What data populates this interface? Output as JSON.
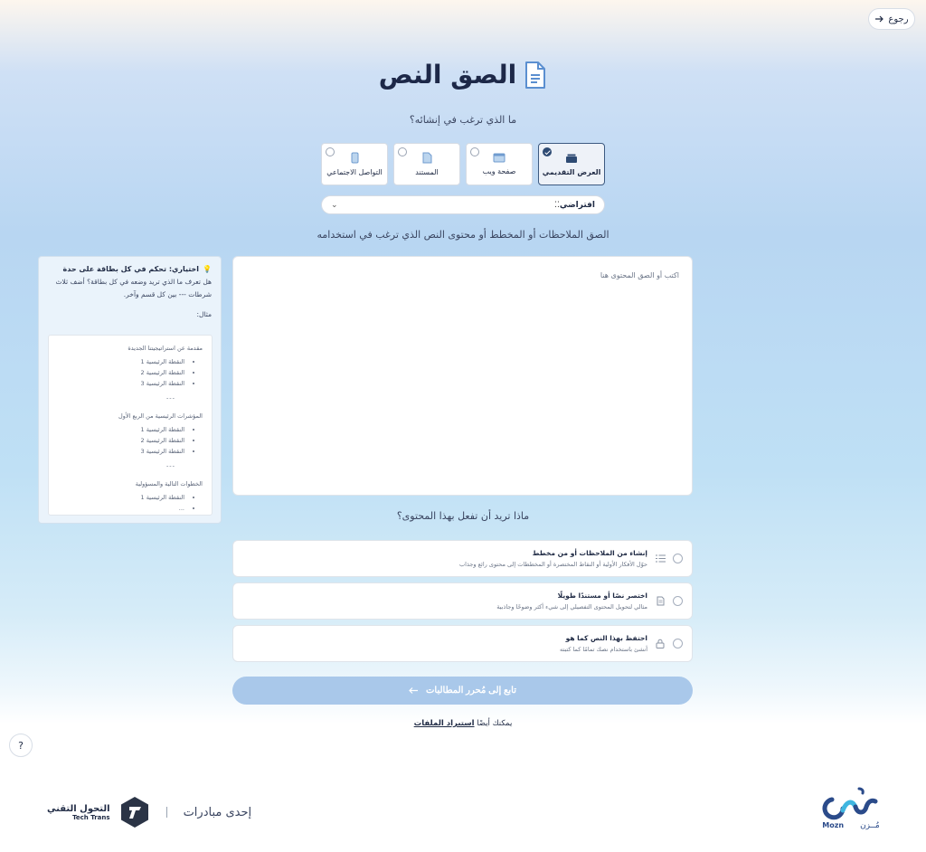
{
  "nav": {
    "back_label": "رجوع"
  },
  "page": {
    "title": "الصق النص",
    "subtitle": "ما الذي ترغب في إنشائه؟"
  },
  "types": [
    {
      "label": "العرض التقديمي",
      "selected": true,
      "icon": "layers-icon"
    },
    {
      "label": "صفحة ويب",
      "selected": false,
      "icon": "webpage-icon"
    },
    {
      "label": "المستند",
      "selected": false,
      "icon": "document-icon"
    },
    {
      "label": "التواصل الاجتماعي",
      "selected": false,
      "icon": "phone-icon"
    }
  ],
  "theme": {
    "value": "افتراضي"
  },
  "paste": {
    "label": "الصق الملاحظات أو المخطط أو محتوى النص الذي ترغب في استخدامه",
    "placeholder": "اكتب أو الصق المحتوى هنا"
  },
  "tip": {
    "title": "اختياري: تحكم في كل بطاقة على حدة",
    "body": "هل تعرف ما الذي تريد وضعه في كل بطاقة؟ أضف ثلاث شرطات --- بين كل قسم وآخر.",
    "example_label": "مثال:",
    "sections": [
      {
        "heading": "مقدمة عن استراتيجيتنا الجديدة",
        "points": [
          "النقطة الرئيسية 1",
          "النقطة الرئيسية 2",
          "النقطة الرئيسية 3"
        ]
      },
      {
        "heading": "المؤشرات الرئيسية من الربع الأول",
        "points": [
          "النقطة الرئيسية 1",
          "النقطة الرئيسية 2",
          "النقطة الرئيسية 3"
        ]
      },
      {
        "heading": "الخطوات التالية والمسؤولية",
        "points": [
          "النقطة الرئيسية 1",
          "..."
        ]
      }
    ],
    "separator": "---"
  },
  "question": "ماذا تريد أن تفعل بهذا المحتوى؟",
  "options": [
    {
      "title": "إنشاء من الملاحظات أو من مخطط",
      "desc": "حوّل الأفكار الأولية أو النقاط المختصرة أو المخططات إلى محتوى رائع وجذاب",
      "icon": "list-icon"
    },
    {
      "title": "اختصر نصًا أو مستندًا طويلًا",
      "desc": "مثالي لتحويل المحتوى التفصيلي إلى شيء أكثر وضوحًا وجاذبية",
      "icon": "doc-lines-icon"
    },
    {
      "title": "احتفظ بهذا النص كما هو",
      "desc": "أنشئ باستخدام نصك تمامًا كما كتبته",
      "icon": "lock-icon"
    }
  ],
  "continue_label": "تابع إلى مُحرر المطالبات",
  "import": {
    "prefix": "يمكنك أيضًا",
    "link": "استيراد الملفات"
  },
  "help_label": "?",
  "footer": {
    "initiative": "إحدى مبادرات",
    "brand_ar": "التحول التقني",
    "brand_en": "Tech Trans",
    "mozn_en": "Mozn",
    "mozn_ar": "مُــزن"
  },
  "colors": {
    "accent": "#2d4a73",
    "button": "#a9c8ea",
    "brand": "#2b4b8a"
  }
}
